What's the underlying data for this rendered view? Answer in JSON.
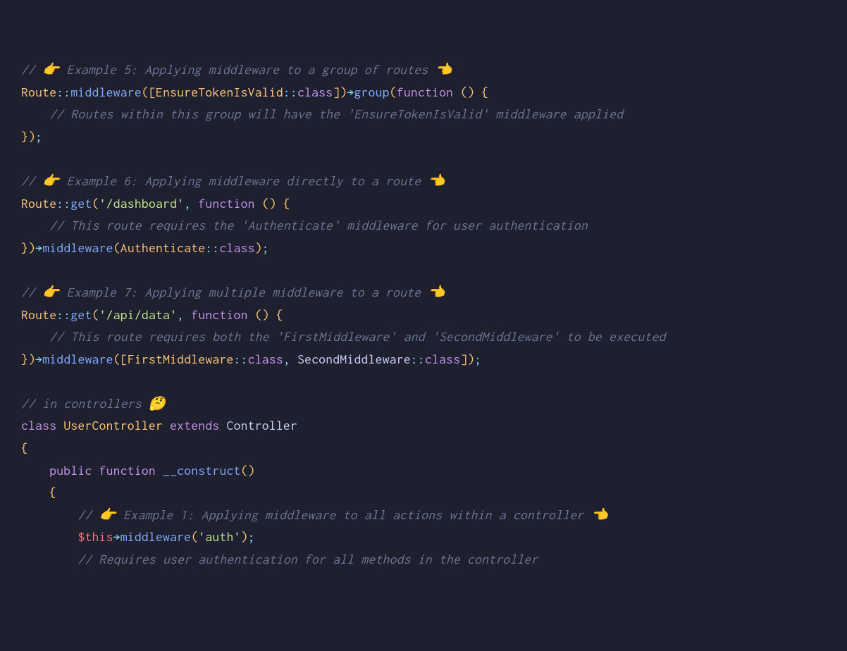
{
  "lines": {
    "l1_comment": "// 👉 Example 5: Applying middleware to a group of routes 👈",
    "l2_route": "Route",
    "l2_scope1": "::",
    "l2_middleware": "middleware",
    "l2_lparen1": "(",
    "l2_lbracket": "[",
    "l2_class1": "EnsureTokenIsValid",
    "l2_scope2": "::",
    "l2_classprop": "class",
    "l2_rbracket": "]",
    "l2_rparen1": ")",
    "l2_arrow": "→",
    "l2_group": "group",
    "l2_lparen2": "(",
    "l2_function": "function",
    "l2_space": " ",
    "l2_lparen3": "(",
    "l2_rparen3": ")",
    "l2_space2": " ",
    "l2_lbrace": "{",
    "l3_comment": "    // Routes within this group will have the 'EnsureTokenIsValid' middleware applied",
    "l4_rbrace": "}",
    "l4_rparen": ")",
    "l4_semi": ";",
    "l6_comment": "// 👉 Example 6: Applying middleware directly to a route 👈",
    "l7_route": "Route",
    "l7_scope": "::",
    "l7_get": "get",
    "l7_lparen1": "(",
    "l7_str": "'/dashboard'",
    "l7_comma": ",",
    "l7_function": "function",
    "l7_lparen2": "(",
    "l7_rparen2": ")",
    "l7_lbrace": "{",
    "l8_comment": "    // This route requires the 'Authenticate' middleware for user authentication",
    "l9_rbrace": "}",
    "l9_rparen1": ")",
    "l9_arrow": "→",
    "l9_middleware": "middleware",
    "l9_lparen2": "(",
    "l9_class": "Authenticate",
    "l9_scope": "::",
    "l9_classprop": "class",
    "l9_rparen2": ")",
    "l9_semi": ";",
    "l11_comment": "// 👉 Example 7: Applying multiple middleware to a route 👈",
    "l12_route": "Route",
    "l12_scope": "::",
    "l12_get": "get",
    "l12_lparen1": "(",
    "l12_str": "'/api/data'",
    "l12_comma": ",",
    "l12_function": "function",
    "l12_lparen2": "(",
    "l12_rparen2": ")",
    "l12_lbrace": "{",
    "l13_comment": "    // This route requires both the 'FirstMiddleware' and 'SecondMiddleware' to be executed",
    "l14_rbrace": "}",
    "l14_rparen1": ")",
    "l14_arrow": "→",
    "l14_middleware": "middleware",
    "l14_lparen2": "(",
    "l14_lbracket": "[",
    "l14_class1": "FirstMiddleware",
    "l14_scope1": "::",
    "l14_classprop1": "class",
    "l14_comma": ",",
    "l14_class2": "SecondMiddleware",
    "l14_scope2": "::",
    "l14_classprop2": "class",
    "l14_rbracket": "]",
    "l14_rparen2": ")",
    "l14_semi": ";",
    "l16_comment": "// in controllers 🤔",
    "l17_class": "class",
    "l17_name": "UserController",
    "l17_extends": "extends",
    "l17_controller": "Controller",
    "l18_lbrace": "{",
    "l19_public": "    public",
    "l19_function": "function",
    "l19_construct": "__construct",
    "l19_lparen": "(",
    "l19_rparen": ")",
    "l20_lbrace": "    {",
    "l21_comment": "        // 👉 Example 1: Applying middleware to all actions within a controller 👈",
    "l22_indent": "        ",
    "l22_this": "$this",
    "l22_arrow": "→",
    "l22_middleware": "middleware",
    "l22_lparen": "(",
    "l22_str": "'auth'",
    "l22_rparen": ")",
    "l22_semi": ";",
    "l23_comment": "        // Requires user authentication for all methods in the controller"
  }
}
